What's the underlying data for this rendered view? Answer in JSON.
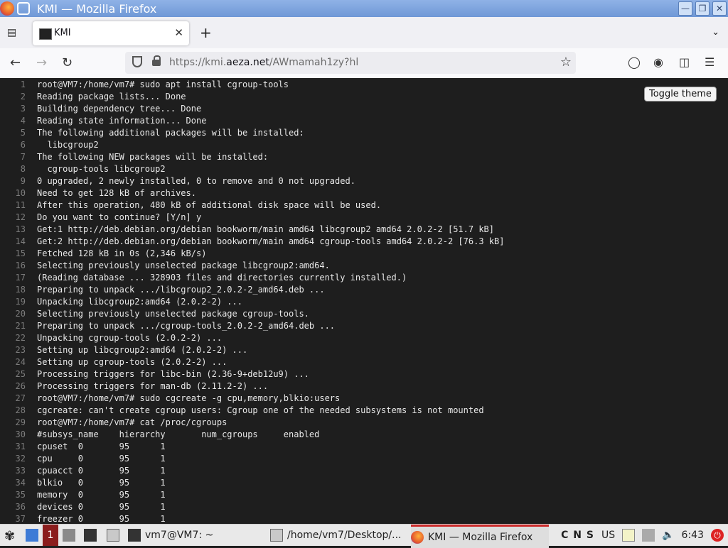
{
  "window": {
    "title": "KMI — Mozilla Firefox"
  },
  "tabs": [
    {
      "label": "KMI"
    }
  ],
  "urlbar": {
    "url_prefix": "https://kmi.",
    "url_domain": "aeza.net",
    "url_path": "/AWmamah1zy?hl"
  },
  "toggle_label": "Toggle theme",
  "terminal_lines": [
    "root@VM7:/home/vm7# sudo apt install cgroup-tools",
    "Reading package lists... Done",
    "Building dependency tree... Done",
    "Reading state information... Done",
    "The following additional packages will be installed:",
    "  libcgroup2",
    "The following NEW packages will be installed:",
    "  cgroup-tools libcgroup2",
    "0 upgraded, 2 newly installed, 0 to remove and 0 not upgraded.",
    "Need to get 128 kB of archives.",
    "After this operation, 480 kB of additional disk space will be used.",
    "Do you want to continue? [Y/n] y",
    "Get:1 http://deb.debian.org/debian bookworm/main amd64 libcgroup2 amd64 2.0.2-2 [51.7 kB]",
    "Get:2 http://deb.debian.org/debian bookworm/main amd64 cgroup-tools amd64 2.0.2-2 [76.3 kB]",
    "Fetched 128 kB in 0s (2,346 kB/s)",
    "Selecting previously unselected package libcgroup2:amd64.",
    "(Reading database ... 328903 files and directories currently installed.)",
    "Preparing to unpack .../libcgroup2_2.0.2-2_amd64.deb ...",
    "Unpacking libcgroup2:amd64 (2.0.2-2) ...",
    "Selecting previously unselected package cgroup-tools.",
    "Preparing to unpack .../cgroup-tools_2.0.2-2_amd64.deb ...",
    "Unpacking cgroup-tools (2.0.2-2) ...",
    "Setting up libcgroup2:amd64 (2.0.2-2) ...",
    "Setting up cgroup-tools (2.0.2-2) ...",
    "Processing triggers for libc-bin (2.36-9+deb12u9) ...",
    "Processing triggers for man-db (2.11.2-2) ...",
    "root@VM7:/home/vm7# sudo cgcreate -g cpu,memory,blkio:users",
    "cgcreate: can't create cgroup users: Cgroup one of the needed subsystems is not mounted",
    "root@VM7:/home/vm7# cat /proc/cgroups",
    "#subsys_name    hierarchy       num_cgroups     enabled",
    "cpuset  0       95      1",
    "cpu     0       95      1",
    "cpuacct 0       95      1",
    "blkio   0       95      1",
    "memory  0       95      1",
    "devices 0       95      1",
    "freezer 0       95      1"
  ],
  "taskbar": {
    "workspace": "1",
    "tasks": [
      {
        "label": "vm7@VM7: ~"
      },
      {
        "label": "/home/vm7/Desktop/..."
      },
      {
        "label": "KMI — Mozilla Firefox"
      }
    ],
    "tray_text": "C N S",
    "layout": "US",
    "clock": "6:43"
  }
}
